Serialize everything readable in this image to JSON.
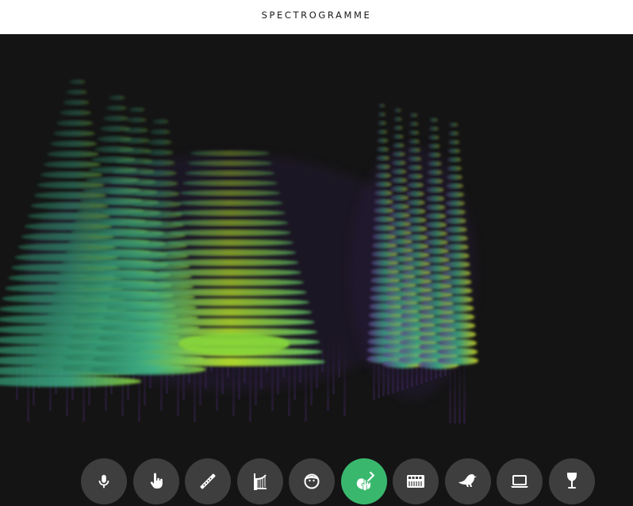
{
  "header": {
    "title": "SPECTROGRAMME"
  },
  "toolbar": {
    "active_index": 5,
    "active_color": "#39b86d",
    "inactive_color": "#3e3e3e",
    "items": [
      {
        "icon": "microphone-icon",
        "name": "tool-microphone"
      },
      {
        "icon": "hand-pointer-icon",
        "name": "tool-draw"
      },
      {
        "icon": "flute-icon",
        "name": "tool-flute"
      },
      {
        "icon": "harp-icon",
        "name": "tool-harp"
      },
      {
        "icon": "face-icon",
        "name": "tool-voice"
      },
      {
        "icon": "guitar-icon",
        "name": "tool-guitar"
      },
      {
        "icon": "synthesizer-icon",
        "name": "tool-synth"
      },
      {
        "icon": "bird-icon",
        "name": "tool-bird"
      },
      {
        "icon": "laptop-icon",
        "name": "tool-laptop"
      },
      {
        "icon": "wine-glass-icon",
        "name": "tool-wine-glass"
      }
    ]
  },
  "colors": {
    "background": "#141414",
    "header": "#ffffff"
  }
}
